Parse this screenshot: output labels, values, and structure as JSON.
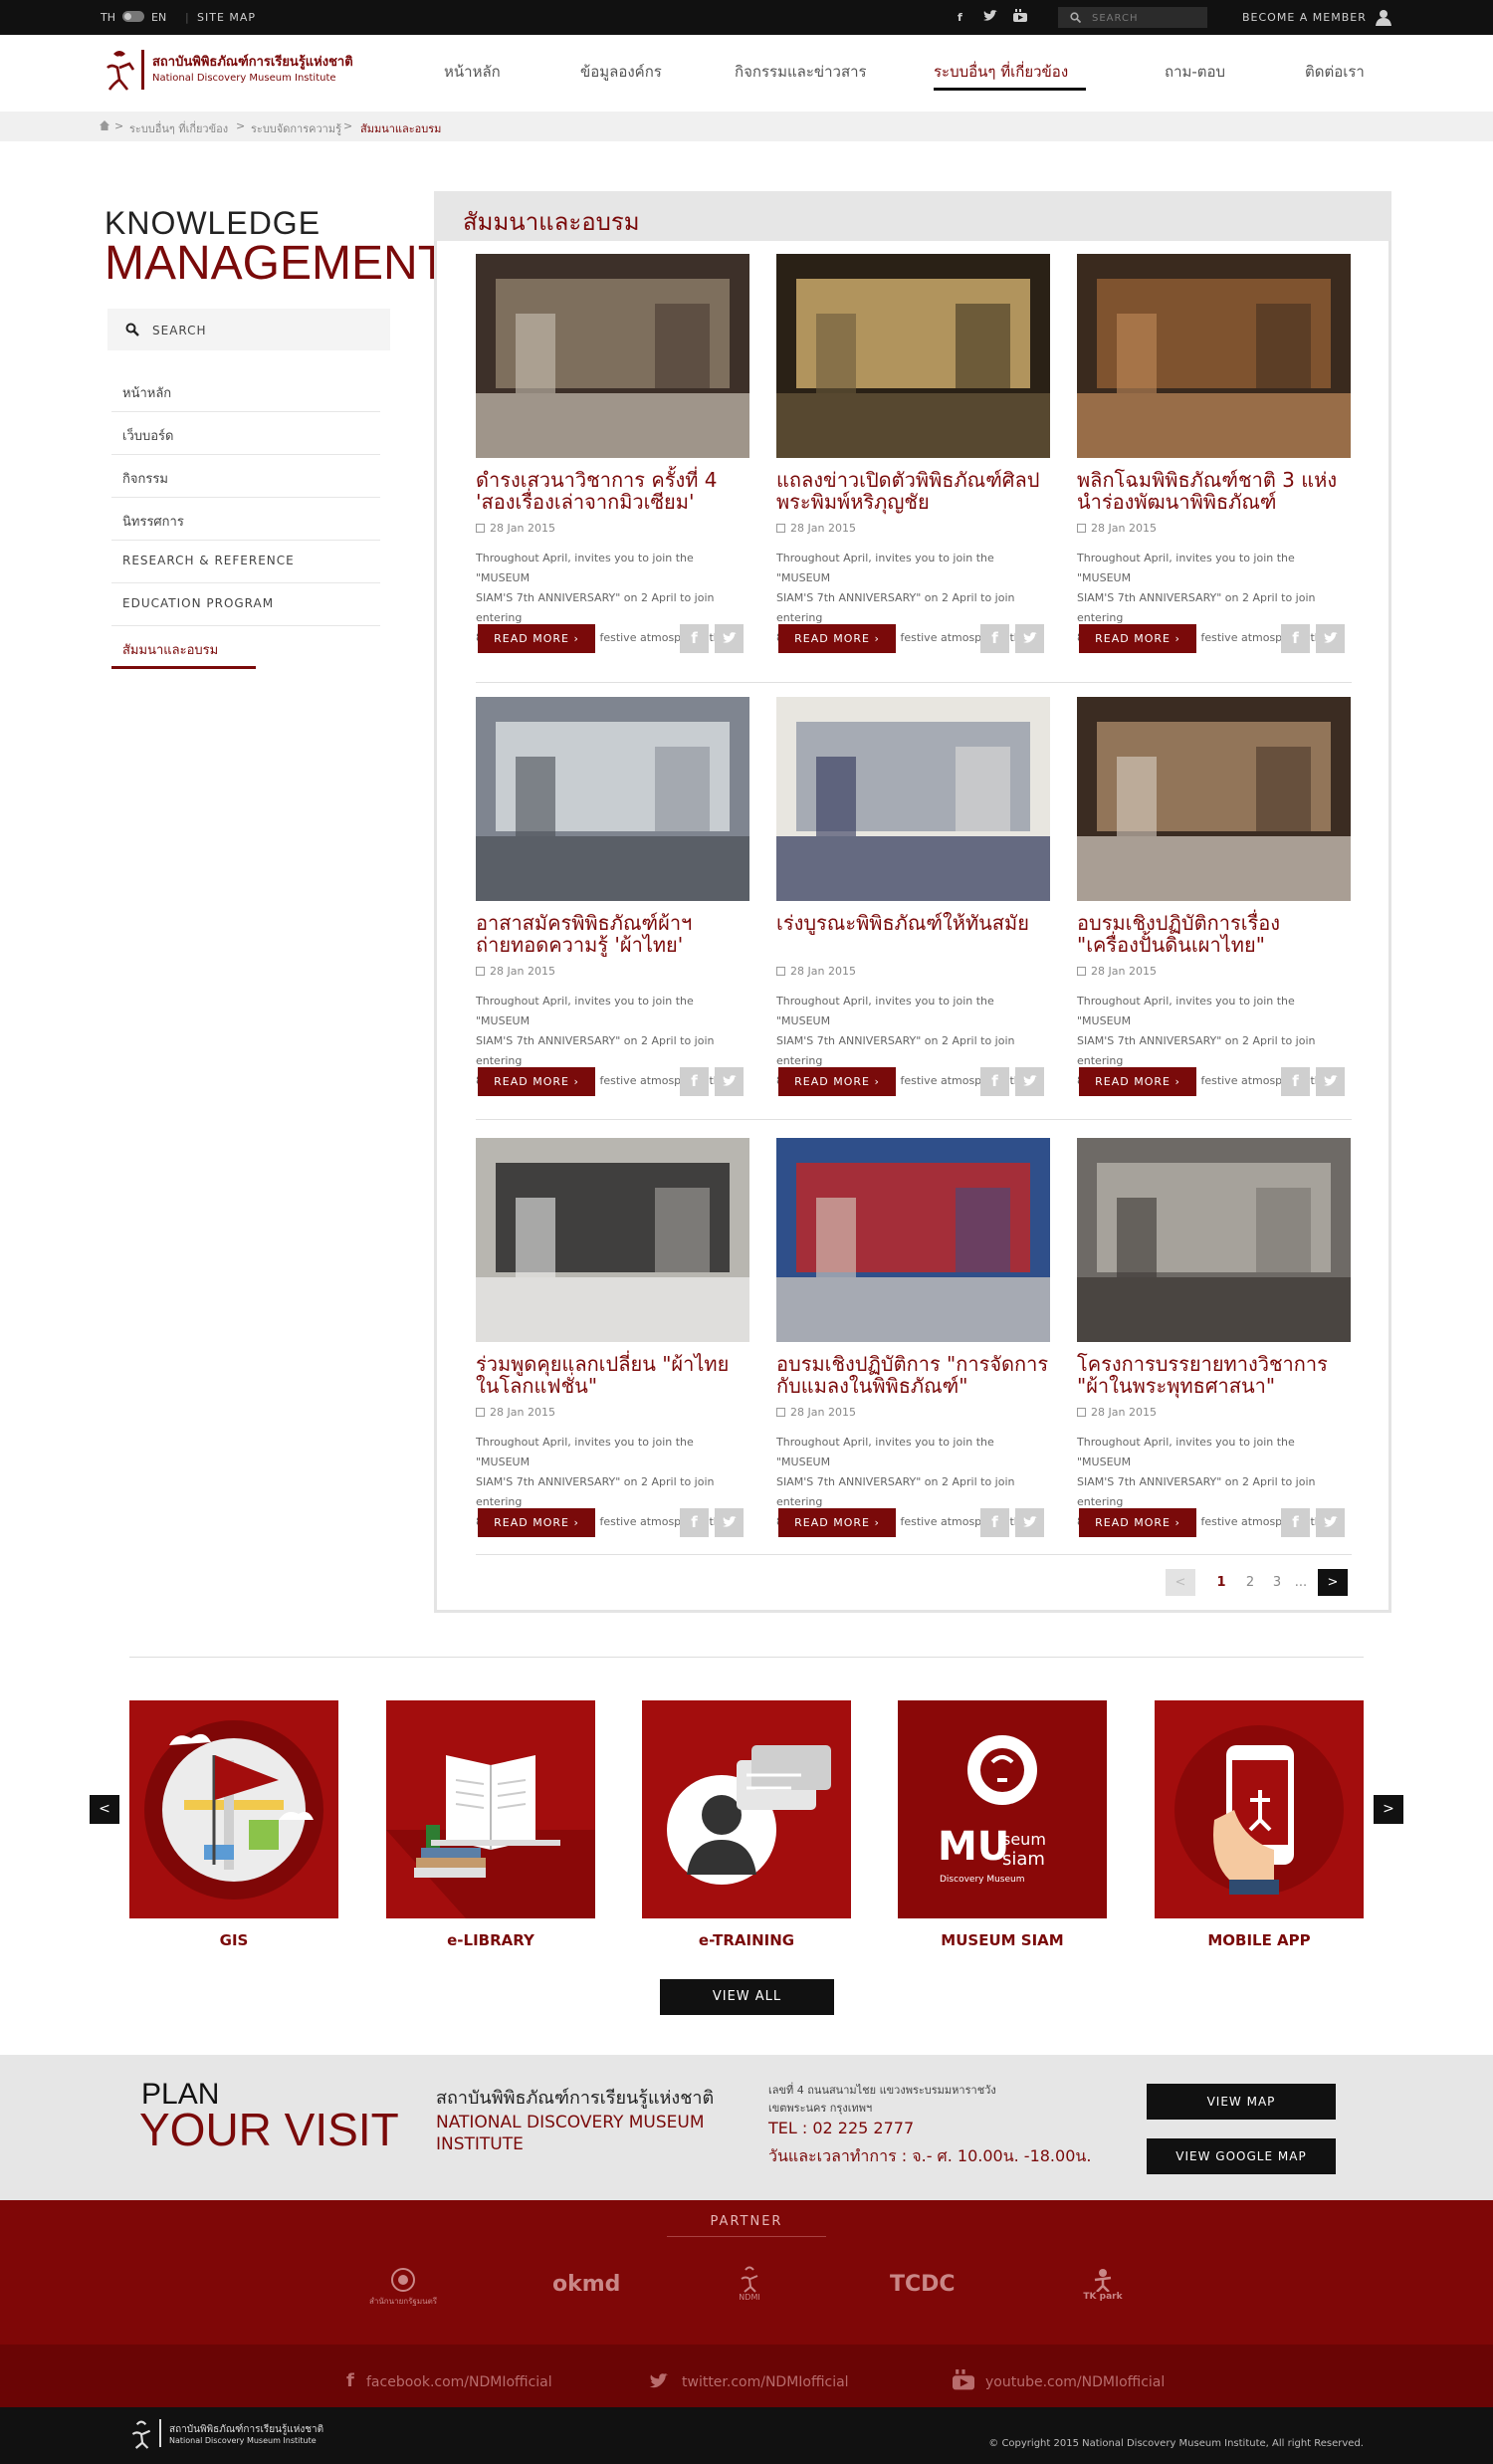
{
  "topbar": {
    "lang_th": "TH",
    "lang_en": "EN",
    "sitemap": "SITE MAP",
    "search_placeholder": "SEARCH",
    "become_member": "BECOME A MEMBER"
  },
  "header": {
    "logo_th": "สถาบันพิพิธภัณฑ์การเรียนรู้แห่งชาติ",
    "logo_en": "National Discovery Museum Institute",
    "nav": [
      "หน้าหลัก",
      "ข้อมูลองค์กร",
      "กิจกรรมและข่าวสาร",
      "ระบบอื่นๆ ที่เกี่ยวข้อง",
      "ถาม-ตอบ",
      "ติดต่อเรา"
    ]
  },
  "breadcrumb": {
    "items": [
      "ระบบอื่นๆ ที่เกี่ยวข้อง",
      "ระบบจัดการความรู้"
    ],
    "current": "สัมมนาและอบรม"
  },
  "sidebar": {
    "title1": "KNOWLEDGE",
    "title2": "MANAGEMENT",
    "search_placeholder": "SEARCH",
    "items": [
      "หน้าหลัก",
      "เว็บบอร์ด",
      "กิจกรรม",
      "นิทรรศการ",
      "RESEARCH & REFERENCE",
      "EDUCATION PROGRAM",
      "สัมมนาและอบรม"
    ]
  },
  "main": {
    "title": "สัมมนาและอบรม",
    "cards": [
      {
        "title": "ดำรงเสวนาวิชาการ ครั้งที่ 4 'สองเรื่องเล่าจากมิวเซียม'",
        "date": "28 Jan 2015"
      },
      {
        "title": "แถลงข่าวเปิดตัวพิพิธภัณฑ์ศิลป พระพิมพ์หริภุญชัย",
        "date": "28 Jan 2015"
      },
      {
        "title": "พลิกโฉมพิพิธภัณฑ์ชาติ 3 แห่ง นำร่องพัฒนาพิพิธภัณฑ์",
        "date": "28 Jan 2015"
      },
      {
        "title": "อาสาสมัครพิพิธภัณฑ์ผ้าฯ ถ่ายทอดความรู้ 'ผ้าไทย'",
        "date": "28 Jan 2015"
      },
      {
        "title": "เร่งบูรณะพิพิธภัณฑ์ให้ทันสมัย",
        "date": "28 Jan 2015"
      },
      {
        "title": "อบรมเชิงปฏิบัติการเรื่อง \"เครื่องปั้นดินเผาไทย\"",
        "date": "28 Jan 2015"
      },
      {
        "title": "ร่วมพูดคุยแลกเปลี่ยน \"ผ้าไทยในโลกแฟชั่น\"",
        "date": "28 Jan 2015"
      },
      {
        "title": "อบรมเชิงปฏิบัติการ \"การจัดการกับแมลงในพิพิธภัณฑ์\"",
        "date": "28 Jan 2015"
      },
      {
        "title": "โครงการบรรยายทางวิชาการ \"ผ้าในพระพุทธศาสนา\"",
        "date": "28 Jan 2015"
      }
    ],
    "excerpt_line1": "Throughout April, invites you to join the \"MUSEUM",
    "excerpt_line2": "SIAM'S 7th ANNIVERSARY\" on 2 April to join entering",
    "excerpt_line3": "8th year together in a festive atmosphere that ..",
    "read_more": "READ MORE",
    "pagination": {
      "pages": [
        "1",
        "2",
        "3"
      ],
      "ellipsis": "...",
      "current": "1"
    }
  },
  "services": {
    "items": [
      "GIS",
      "e-LIBRARY",
      "e-TRAINING",
      "MUSEUM SIAM",
      "MOBILE APP"
    ],
    "view_all": "VIEW ALL"
  },
  "plan": {
    "title1": "PLAN",
    "title2": "YOUR VISIT",
    "org_th": "สถาบันพิพิธภัณฑ์การเรียนรู้แห่งชาติ",
    "org_en1": "NATIONAL DISCOVERY MUSEUM",
    "org_en2": "INSTITUTE",
    "address1": "เลขที่ 4 ถนนสนามไชย แขวงพระบรมมหาราชวัง",
    "address2": "เขตพระนคร กรุงเทพฯ",
    "tel": "TEL : 02 225 2777",
    "hours": "วันและเวลาทำการ : จ.- ศ. 10.00น. -18.00น.",
    "view_map": "VIEW MAP",
    "view_google_map": "VIEW GOOGLE MAP"
  },
  "partner": {
    "title": "PARTNER",
    "items": [
      "สำนักนายกรัฐมนตรี",
      "okmd",
      "NDMI",
      "TCDC",
      "TK park"
    ]
  },
  "social": {
    "facebook": "facebook.com/NDMIofficial",
    "twitter": "twitter.com/NDMIofficial",
    "youtube": "youtube.com/NDMIofficial"
  },
  "footer": {
    "logo_th": "สถาบันพิพิธภัณฑ์การเรียนรู้แห่งชาติ",
    "logo_en": "National Discovery Museum Institute",
    "copyright": "© Copyright 2015 National Discovery Museum Institute, All right Reserved."
  },
  "colors": {
    "brand": "#7a0a0a",
    "footer": "#7f0707",
    "dark": "#111111"
  }
}
